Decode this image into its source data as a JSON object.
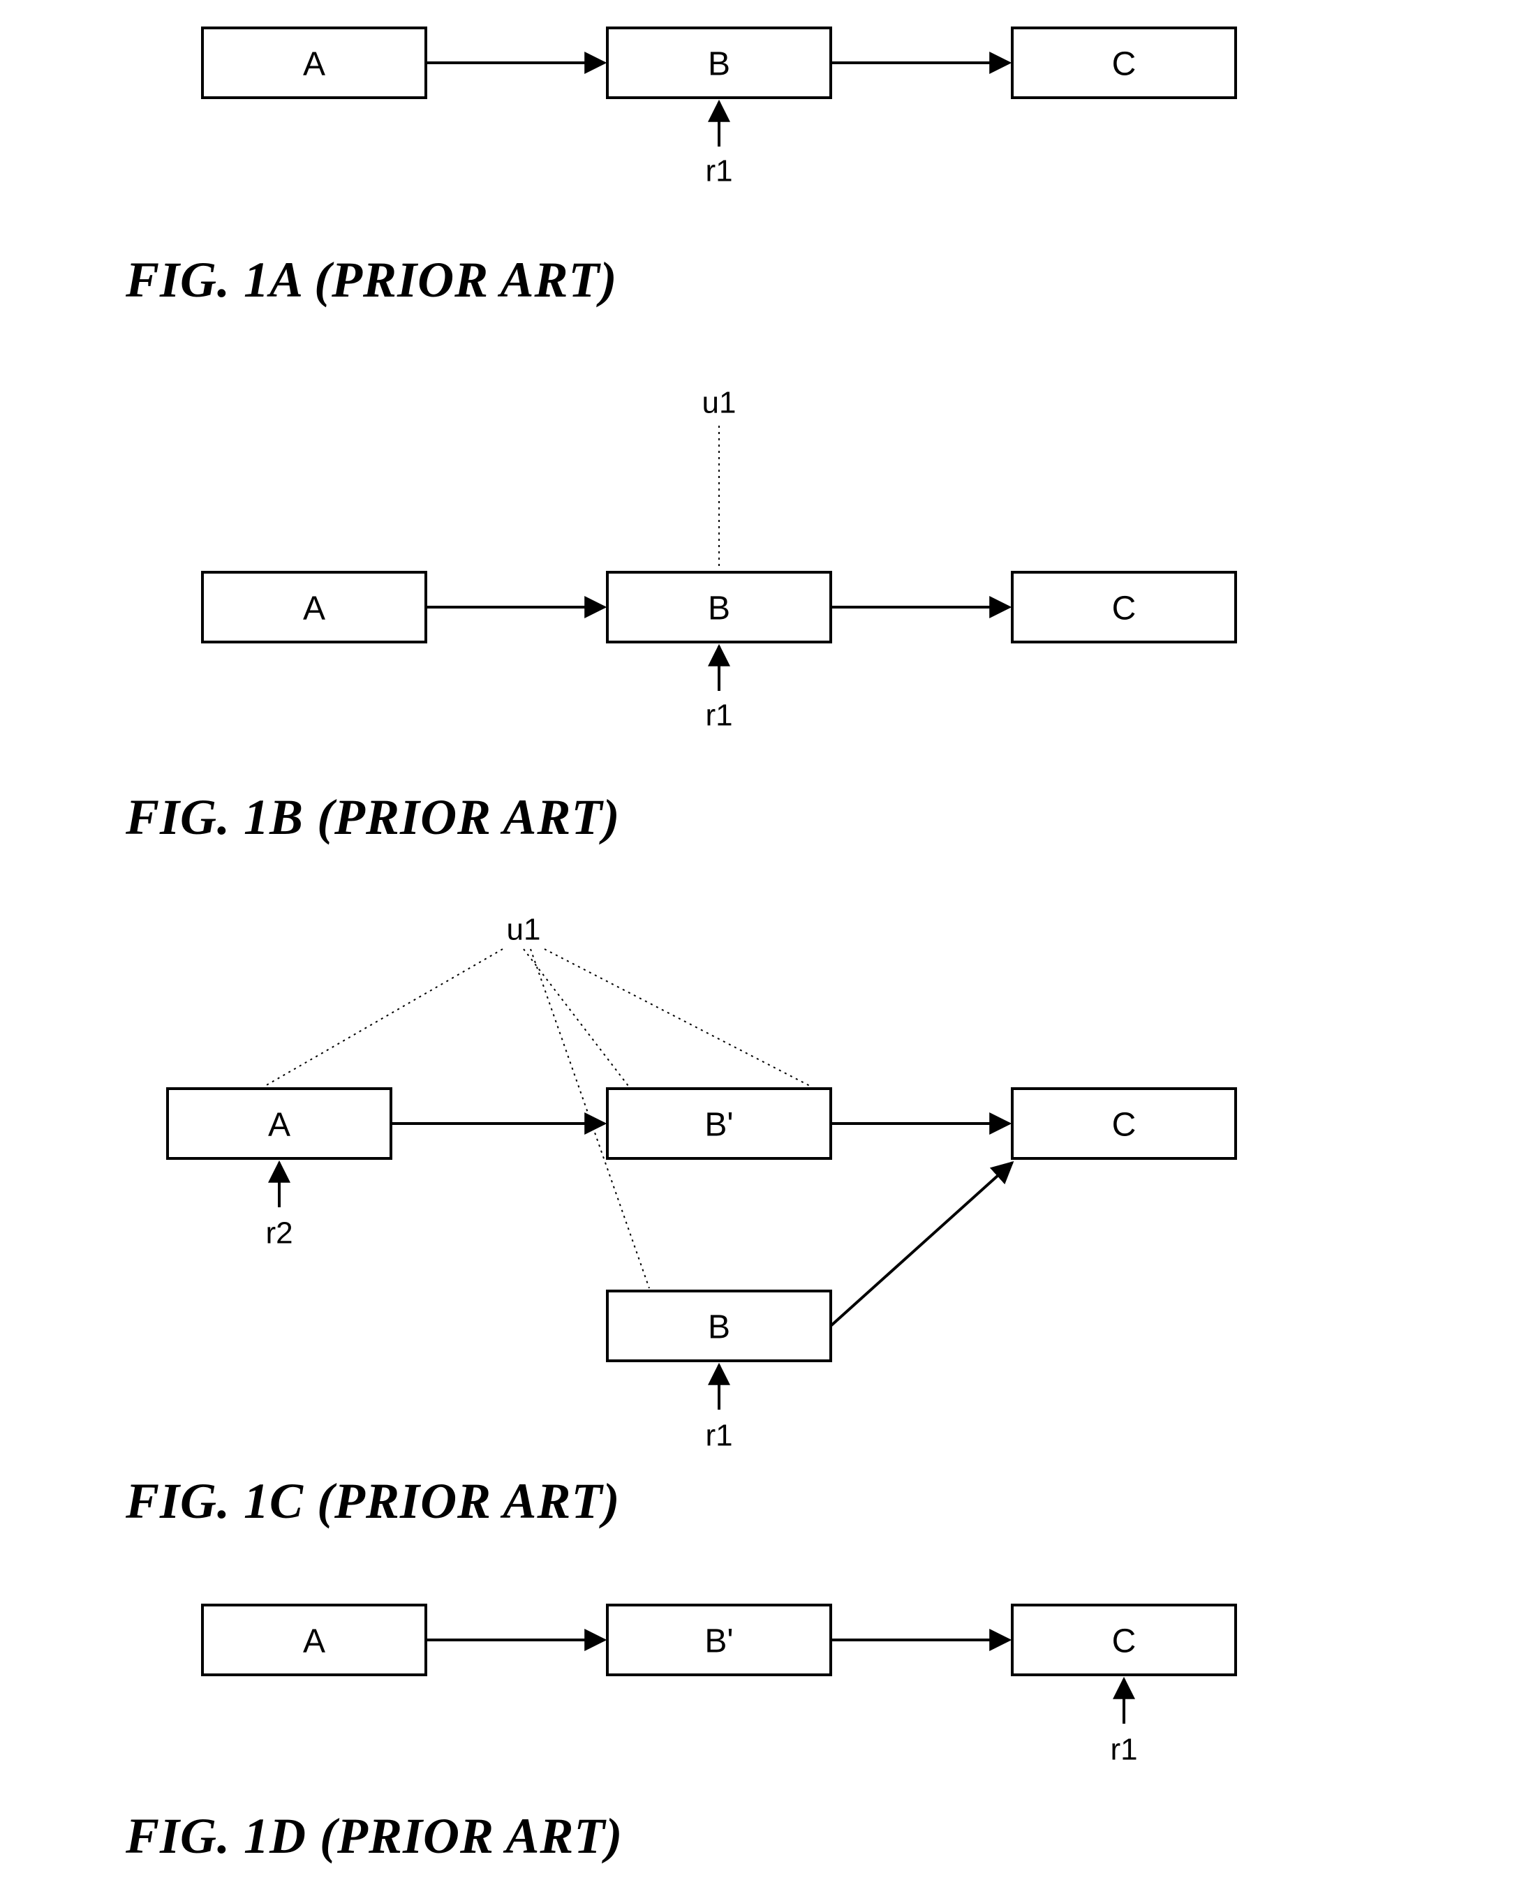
{
  "figA": {
    "caption": "FIG. 1A (PRIOR ART)",
    "boxes": {
      "a": "A",
      "b": "B",
      "c": "C"
    },
    "labels": {
      "r1": "r1"
    }
  },
  "figB": {
    "caption": "FIG. 1B (PRIOR ART)",
    "boxes": {
      "a": "A",
      "b": "B",
      "c": "C"
    },
    "labels": {
      "r1": "r1",
      "u1": "u1"
    }
  },
  "figC": {
    "caption": "FIG. 1C (PRIOR ART)",
    "boxes": {
      "a": "A",
      "bprime": "B'",
      "b": "B",
      "c": "C"
    },
    "labels": {
      "r1": "r1",
      "r2": "r2",
      "u1": "u1"
    }
  },
  "figD": {
    "caption": "FIG. 1D (PRIOR ART)",
    "boxes": {
      "a": "A",
      "bprime": "B'",
      "c": "C"
    },
    "labels": {
      "r1": "r1"
    }
  }
}
